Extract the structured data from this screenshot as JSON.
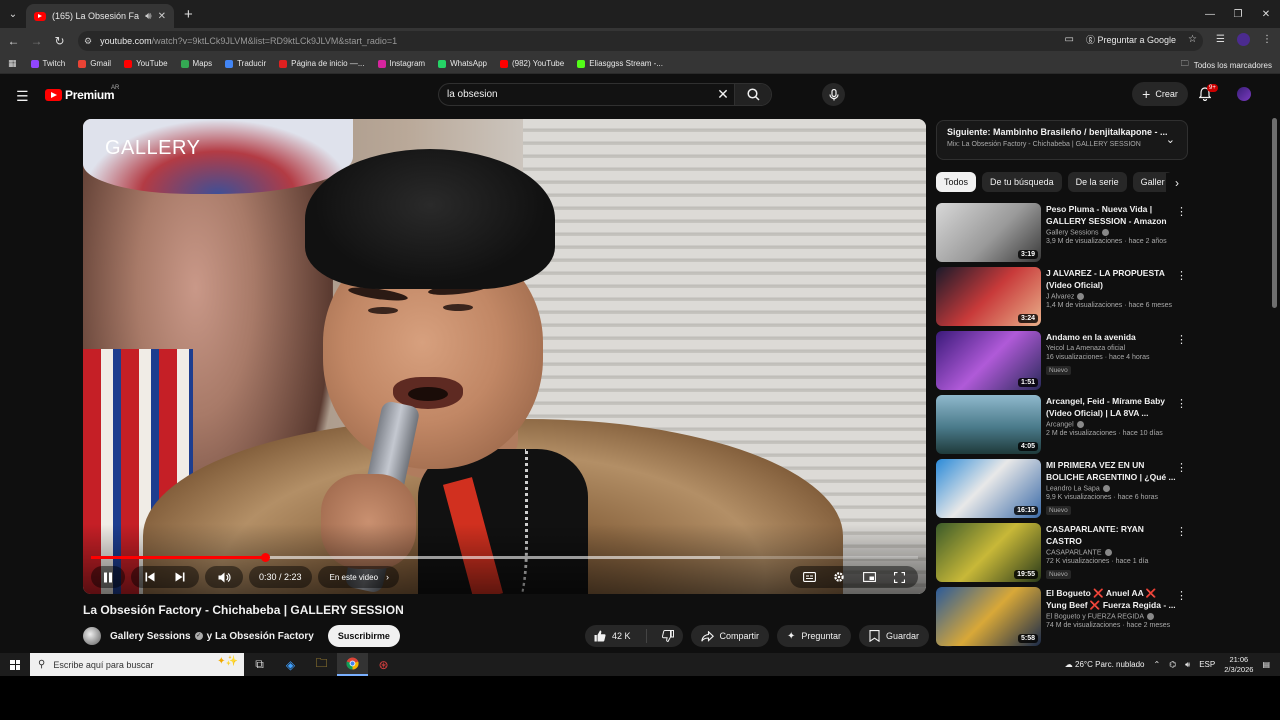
{
  "browser": {
    "tab_title": "(165) La Obsesión Factory",
    "url_host": "youtube.com",
    "url_path": "/watch?v=9ktLCk9JLVM&list=RD9ktLCk9JLVM&start_radio=1",
    "ask_google": "Preguntar a Google",
    "bookmarks": [
      {
        "label": "Twitch",
        "color": "#9146ff"
      },
      {
        "label": "Gmail",
        "color": "#ea4335"
      },
      {
        "label": "YouTube",
        "color": "#ff0000"
      },
      {
        "label": "Maps",
        "color": "#34a853"
      },
      {
        "label": "Traducir",
        "color": "#4285f4"
      },
      {
        "label": "Página de inicio —...",
        "color": "#e02020"
      },
      {
        "label": "Instagram",
        "color": "#d6249f"
      },
      {
        "label": "WhatsApp",
        "color": "#25d366"
      },
      {
        "label": "(982) YouTube",
        "color": "#ff0000"
      },
      {
        "label": "Eliasggss Stream -...",
        "color": "#53fc18"
      }
    ],
    "all_bookmarks": "Todos los marcadores"
  },
  "yt": {
    "logo": "Premium",
    "logo_country": "AR",
    "search_value": "la obsesion",
    "create_label": "Crear",
    "notif_count": "9+"
  },
  "player": {
    "overlay_logo": "GALLERY",
    "time": "0:30 / 2:23",
    "chapter": "En este video",
    "progress": 0.21,
    "buffered": 0.76
  },
  "video": {
    "title": "La Obsesión Factory - Chichabeba | GALLERY SESSION",
    "channel": "Gallery Sessions",
    "channel_and": "y La Obsesión Factory",
    "subscribe": "Suscribirme",
    "likes": "42 K",
    "share": "Compartir",
    "ask": "Preguntar",
    "save": "Guardar"
  },
  "sidebar": {
    "next_title": "Siguiente: Mambinho Brasileño / benjitalkapone - ...",
    "next_sub": "Mix: La Obsesión Factory - Chichabeba | GALLERY SESSION",
    "chips": [
      "Todos",
      "De tu búsqueda",
      "De la serie",
      "Galler"
    ],
    "recs": [
      {
        "title": "Peso Pluma - Nueva Vida | GALLERY SESSION - Amazon ...",
        "channel": "Gallery Sessions",
        "verified": true,
        "meta": "3,9 M de visualizaciones · hace 2 años",
        "badge": "",
        "duration": "3:19",
        "thumb": "linear-gradient(135deg,#d8d8d8,#9a9a9a 55%,#3a3a3a)"
      },
      {
        "title": "J ALVAREZ - LA PROPUESTA (Video Oficial)",
        "channel": "J Alvarez",
        "verified": true,
        "meta": "1,4 M de visualizaciones · hace 6 meses",
        "badge": "",
        "duration": "3:24",
        "thumb": "linear-gradient(135deg,#1a1a2a,#c83a3a 50%,#e9b08a)"
      },
      {
        "title": "Andamo en la avenida",
        "channel": "Yeicol La Amenaza oficial",
        "verified": false,
        "meta": "16 visualizaciones · hace 4 horas",
        "badge": "Nuevo",
        "duration": "1:51",
        "thumb": "linear-gradient(135deg,#3a1a7a,#b05ad8 50%,#2a2a5a)"
      },
      {
        "title": "Arcangel, Feid - Mírame Baby (Video Oficial) | LA 8VA ...",
        "channel": "Arcangel",
        "verified": true,
        "meta": "2 M de visualizaciones · hace 10 días",
        "badge": "",
        "duration": "4:05",
        "thumb": "linear-gradient(180deg,#8fb8cc,#4a7a8a 55%,#1f3a3a)"
      },
      {
        "title": "MI PRIMERA VEZ EN UN BOLICHE ARGENTINO | ¿Qué ...",
        "channel": "Leandro La Sapa",
        "verified": true,
        "meta": "9,9 K visualizaciones · hace 6 horas",
        "badge": "Nuevo",
        "duration": "16:15",
        "thumb": "linear-gradient(135deg,#2a8ad8,#e8e8e8 45%,#3a6aa8)"
      },
      {
        "title": "CASAPARLANTE: RYAN CASTRO",
        "channel": "CASAPARLANTE",
        "verified": true,
        "meta": "72 K visualizaciones · hace 1 día",
        "badge": "Nuevo",
        "duration": "19:55",
        "thumb": "linear-gradient(135deg,#3a5a2a,#c8b838 50%,#2a3a1a)"
      },
      {
        "title": "El Bogueto ❌ Anuel AA ❌ Yung Beef ❌ Fuerza Regida - ...",
        "channel": "El Bogueto y FUERZA REGIDA",
        "verified": true,
        "meta": "74 M de visualizaciones · hace 2 meses",
        "badge": "",
        "duration": "5:58",
        "thumb": "linear-gradient(135deg,#2a5a9a,#d8a838 50%,#1a2a4a)"
      }
    ]
  },
  "taskbar": {
    "search_placeholder": "Escribe aquí para buscar",
    "weather": "26°C  Parc. nublado",
    "lang": "ESP",
    "time": "21:06",
    "date": "2/3/2026"
  }
}
